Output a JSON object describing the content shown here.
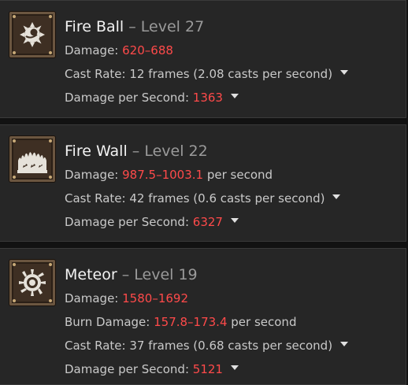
{
  "skills": [
    {
      "name": "Fire Ball",
      "separator": "–",
      "level": "Level 27",
      "icon": "fireball-icon",
      "damage": {
        "label": "Damage:",
        "value": "620–688"
      },
      "cast_rate": {
        "label": "Cast Rate:",
        "value": "12 frames (2.08 casts per second)"
      },
      "dps": {
        "label": "Damage per Second:",
        "value": "1363"
      }
    },
    {
      "name": "Fire Wall",
      "separator": "–",
      "level": "Level 22",
      "icon": "firewall-icon",
      "damage": {
        "label": "Damage:",
        "value": "987.5–1003.1",
        "suffix": "per second"
      },
      "cast_rate": {
        "label": "Cast Rate:",
        "value": "42 frames (0.6 casts per second)"
      },
      "dps": {
        "label": "Damage per Second:",
        "value": "6327"
      }
    },
    {
      "name": "Meteor",
      "separator": "–",
      "level": "Level 19",
      "icon": "meteor-icon",
      "damage": {
        "label": "Damage:",
        "value": "1580–1692"
      },
      "burn_damage": {
        "label": "Burn Damage:",
        "value": "157.8–173.4",
        "suffix": "per second"
      },
      "cast_rate": {
        "label": "Cast Rate:",
        "value": "37 frames (0.68 casts per second)"
      },
      "dps": {
        "label": "Damage per Second:",
        "value": "5121"
      }
    }
  ],
  "colors": {
    "highlight": "#ff4a4a",
    "card_bg": "#262626",
    "page_bg": "#121212"
  }
}
